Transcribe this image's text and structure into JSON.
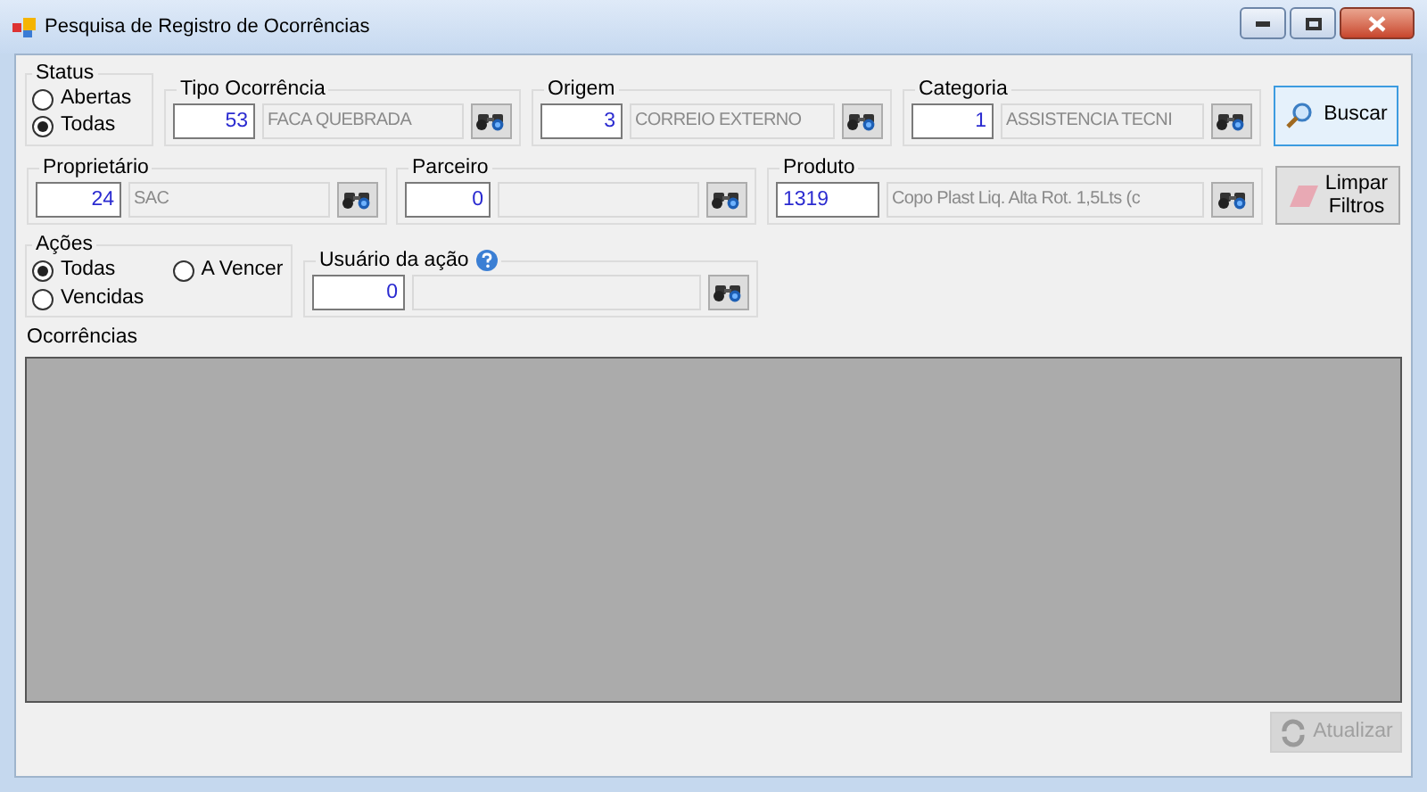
{
  "window": {
    "title": "Pesquisa de Registro de Ocorrências"
  },
  "status": {
    "title": "Status",
    "options": [
      {
        "label": "Abertas",
        "selected": false
      },
      {
        "label": "Todas",
        "selected": true
      }
    ]
  },
  "filters": [
    {
      "label": "Tipo Ocorrência",
      "code": "53",
      "description": "FACA QUEBRADA"
    },
    {
      "label": "Origem",
      "code": "3",
      "description": "CORREIO EXTERNO"
    },
    {
      "label": "Categoria",
      "code": "1",
      "description": "ASSISTENCIA TECNI"
    },
    {
      "label": "Proprietário",
      "code": "24",
      "description": "SAC"
    },
    {
      "label": "Parceiro",
      "code": "0"
    },
    {
      "label": "Produto",
      "code": "1319",
      "description": "Copo Plast Liq. Alta Rot. 1,5Lts (c"
    },
    {
      "label": "Usuário da ação",
      "code": "0",
      "help": true
    }
  ],
  "acoes": {
    "title": "Ações",
    "options": [
      {
        "label": "Todas",
        "selected": true
      },
      {
        "label": "A Vencer",
        "selected": false
      },
      {
        "label": "Vencidas",
        "selected": false
      }
    ]
  },
  "buttons": {
    "buscar": {
      "label": "Buscar",
      "focused": true
    },
    "limpar": {
      "label": "Limpar Filtros"
    },
    "atualizar": {
      "label": "Atualizar",
      "disabled": true
    }
  },
  "grid": {
    "title": "Ocorrências"
  }
}
